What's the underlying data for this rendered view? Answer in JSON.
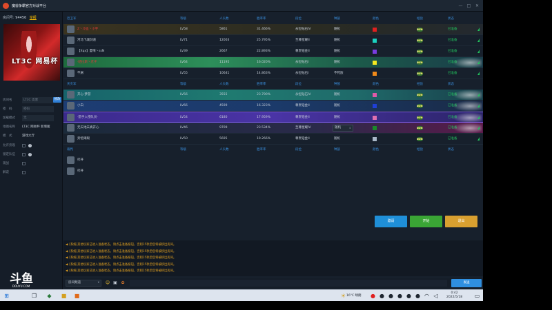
{
  "window": {
    "title": "魔兽争霸官方对战平台",
    "minimize": "—",
    "maximize": "□",
    "close": "✕"
  },
  "left_panel": {
    "room_label": "房间号:",
    "room_number": "94456",
    "room_tag": "举报",
    "avatar_text": "LT3C 网易杯",
    "fields": [
      {
        "label": "房间名",
        "value": "LT3C 奥塞",
        "type": "input"
      },
      {
        "label": "密　码",
        "value": "密码",
        "type": "input"
      },
      {
        "label": "加载模式",
        "value": "无",
        "type": "input"
      },
      {
        "label": "地图名称",
        "value": "LT3C 网易杯 新增版",
        "type": "text"
      },
      {
        "label": "模　式",
        "value": "游戏大厅",
        "type": "text"
      },
      {
        "label": "允许旁观",
        "value": "",
        "type": "check"
      },
      {
        "label": "锁定队伍",
        "value": "",
        "type": "check"
      },
      {
        "label": "观战",
        "value": "",
        "type": "check"
      },
      {
        "label": "解说",
        "value": "",
        "type": "check"
      }
    ],
    "modify_button": "修改"
  },
  "table": {
    "columns": [
      "等级",
      "人头数",
      "胜率率",
      "段位",
      "种族",
      "颜色",
      "经验",
      "状态"
    ],
    "teams": [
      {
        "name": "近卫军",
        "rows": [
          {
            "name": "Z丶冷血丶小宇",
            "level": "LV58",
            "kills": "5861",
            "winrate": "31.466%",
            "rank": "永恒钻石IV",
            "race": "随机",
            "color": "#e02020",
            "exp": "50%",
            "status": "已准备",
            "style": "hl-gold"
          },
          {
            "name": "河马飞城剑道",
            "level": "LV71",
            "kills": "12003",
            "winrate": "25.795%",
            "rank": "至尊星耀II",
            "race": "随机",
            "color": "#1bd1c0",
            "exp": "50%",
            "status": "已准备",
            "style": ""
          },
          {
            "name": "【Xqx】夏晴丶ssN",
            "level": "LV39",
            "kills": "2667",
            "winrate": "22.893%",
            "rank": "尊贵铂金II",
            "race": "随机",
            "color": "#7a3ce0",
            "exp": "50%",
            "status": "已准备",
            "style": ""
          },
          {
            "name": "·哈拉斯丶老子",
            "level": "LV64",
            "kills": "11195",
            "winrate": "16.020%",
            "rank": "永恒钻石I",
            "race": "随机",
            "color": "#f5e820",
            "exp": "50%",
            "status": "已准备",
            "style": "hl-green"
          },
          {
            "name": "不屑",
            "level": "LV55",
            "kills": "10641",
            "winrate": "14.863%",
            "rank": "永恒钻石I",
            "race": "不死族",
            "color": "#f08a1a",
            "exp": "50%",
            "status": "已准备",
            "style": ""
          }
        ]
      },
      {
        "name": "天灾军",
        "rows": [
          {
            "name": "开心·梦游",
            "level": "LV56",
            "kills": "3555",
            "winrate": "23.790%",
            "rank": "永恒钻石IV",
            "race": "随机",
            "color": "#e05aa8",
            "exp": "50%",
            "status": "已准备",
            "style": "hl-teal"
          },
          {
            "name": "小白",
            "level": "LV66",
            "kills": "4599",
            "winrate": "16.323%",
            "rank": "尊贵铂金II",
            "race": "随机",
            "color": "#1f3fd6",
            "exp": "50%",
            "status": "已准备",
            "style": "hl-blue"
          },
          {
            "name": "·猎手入侵队员·",
            "level": "LV54",
            "kills": "6180",
            "winrate": "17.959%",
            "rank": "尊贵铂金II",
            "race": "随机",
            "color": "#e070b0",
            "exp": "50%",
            "status": "已准备",
            "style": "hl-purple"
          },
          {
            "name": "无天地未真开心",
            "level": "LV46",
            "kills": "9709",
            "winrate": "23.534%",
            "rank": "至尊星耀IV",
            "race": "随机",
            "color": "#1a8a2a",
            "exp": "50%",
            "status": "已准备",
            "style": "hl-mag",
            "dropdown": true
          },
          {
            "name": "旁悟果眼",
            "level": "LV50",
            "kills": "5695",
            "winrate": "19.266%",
            "rank": "尊贵铂金II",
            "race": "随机",
            "color": "#a9b8c8",
            "exp": "50%",
            "status": "已准备",
            "style": ""
          }
        ]
      }
    ],
    "observers": {
      "name": "裁判",
      "rows": [
        {
          "name": "打开"
        },
        {
          "name": "打开"
        }
      ]
    }
  },
  "actions": {
    "invite": "邀请",
    "start": "开始",
    "leave": "退出"
  },
  "chat": {
    "messages": [
      "[系统]其他玩家已进入准备状态，请点击准备按钮，否则15秒后您将被移出房间。",
      "[系统]其他玩家已进入准备状态，请点击准备按钮，否则15秒后您将被移出房间。",
      "[系统]其他玩家已进入准备状态，请点击准备按钮，否则15秒后您将被移出房间。",
      "[系统]其他玩家已进入准备状态，请点击准备按钮，否则15秒后您将被移出房间。",
      "[系统]其他玩家已进入准备状态，请点击准备按钮，否则15秒后您将被移出房间。"
    ],
    "channel": "房间频道",
    "send": "发送"
  },
  "watermark": {
    "big": "斗鱼",
    "small": "DOUYU.COM"
  },
  "taskbar": {
    "weather": "16°C 晴朗",
    "time": "0:42",
    "date": "2022/5/18"
  }
}
